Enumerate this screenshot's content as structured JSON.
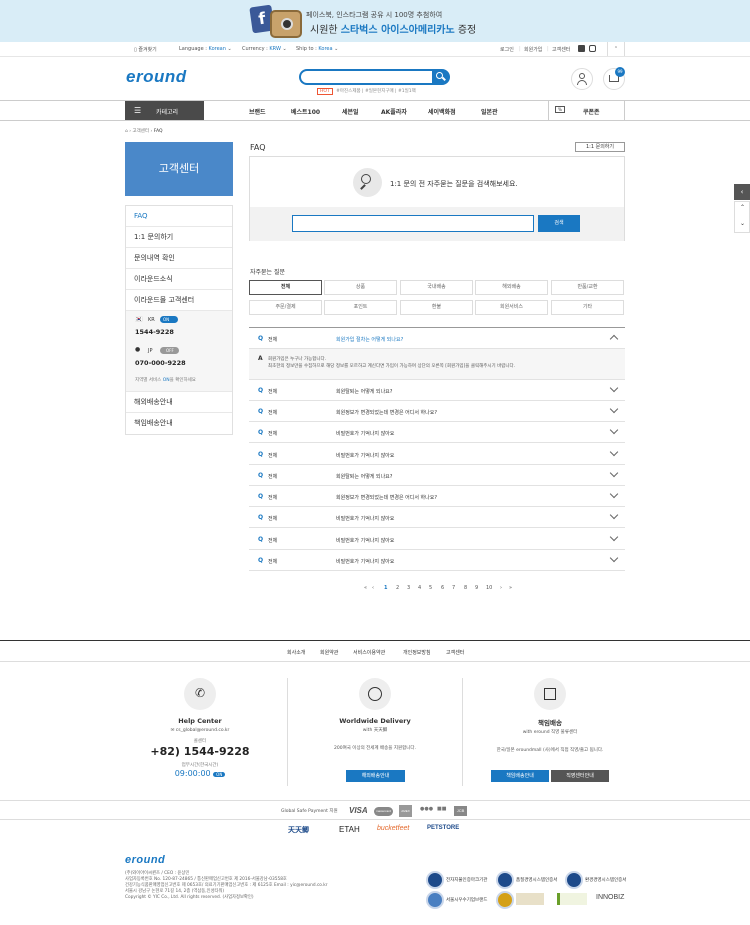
{
  "banner": {
    "fb_letter": "f",
    "line1": "페이스북, 인스타그램 공유 시 100명 추첨하여",
    "line2_prefix": "시원한 ",
    "line2_highlight": "스타벅스 아이스아메리카노",
    "line2_suffix": " 증정"
  },
  "util": {
    "bookmark": "즐겨찾기",
    "language_label": "Language :",
    "language_value": "Korean",
    "currency_label": "Currency :",
    "currency_value": "KRW",
    "ship_label": "Ship to :",
    "ship_value": "Korea",
    "login": "로그인",
    "join": "회원가입",
    "cs": "고객센터"
  },
  "header": {
    "logo": "eround",
    "search_placeholder": "",
    "search_tags": [
      "HOT",
      "#마진스제품",
      "#일본현지구매",
      "#1일1팩"
    ],
    "cart_count": "99"
  },
  "nav": {
    "category": "카테고리",
    "items": [
      "브랜드",
      "베스트100",
      "세븐일",
      "AK플라자",
      "세이백화점",
      "일본관"
    ],
    "coupon": "쿠폰존"
  },
  "breadcrumb": [
    "고객센터",
    "FAQ"
  ],
  "sidebar": {
    "title": "고객센터",
    "items": [
      "FAQ",
      "1:1 문의하기",
      "문의내역 확인",
      "이라운드소식",
      "이라운드몰 고객센터"
    ],
    "cs_kr": {
      "country": "KR",
      "status": "ON",
      "phone": "1544-9228"
    },
    "cs_jp": {
      "country": "JP",
      "status": "OFF",
      "phone": "070-000-9228"
    },
    "cs_note_prefix": "지역별 서비스 ",
    "cs_note_on": "ON",
    "cs_note_suffix": "을 확인하세요",
    "items2": [
      "해외배송안내",
      "책임배송안내"
    ]
  },
  "faq": {
    "title": "FAQ",
    "inquiry_button": "1:1 문의하기",
    "search_heading": "1:1 문의 전 자주묻는 질문을 검색해보세요.",
    "search_input": "",
    "search_button": "검색",
    "categories_title": "자주묻는 질문",
    "categories": [
      "전체",
      "상품",
      "국내배송",
      "해외배송",
      "반품/교환",
      "주문/결제",
      "포인트",
      "환불",
      "회원서비스",
      "기타"
    ],
    "open_answer_line1": "회원가입은 누구나 가능합니다.",
    "open_answer_line2": "최초한의 정보만을 수집하므로 해당 정보를 모르하고 계신다면 가입이 가능하며 상단의 오른쪽 [회원가입]을 클릭해주시기 바랍니다.",
    "rows": [
      {
        "cat": "전체",
        "q": "회원가입 절차는 어떻게 되나요?"
      },
      {
        "cat": "전체",
        "q": "회원탈퇴는 어떻게 되나요?"
      },
      {
        "cat": "전체",
        "q": "회원정보가 변경되었는데 변경은 어디서 하나요?"
      },
      {
        "cat": "전체",
        "q": "비밀번호가 기억나지 않아요"
      },
      {
        "cat": "전체",
        "q": "비밀번호가 기억나지 않아요"
      },
      {
        "cat": "전체",
        "q": "회원탈퇴는 어떻게 되나요?"
      },
      {
        "cat": "전체",
        "q": "회원정보가 변경되었는데 변경은 어디서 하나요?"
      },
      {
        "cat": "전체",
        "q": "비밀번호가 기억나지 않아요"
      },
      {
        "cat": "전체",
        "q": "비밀번호가 기억나지 않아요"
      },
      {
        "cat": "전체",
        "q": "비밀번호가 기억나지 않아요"
      }
    ],
    "pages": [
      "1",
      "2",
      "3",
      "4",
      "5",
      "6",
      "7",
      "8",
      "9",
      "10"
    ]
  },
  "footer": {
    "links": [
      "회사소개",
      "회원약관",
      "서비스이용약관",
      "개인정보방침",
      "고객센터"
    ],
    "help": {
      "title": "Help Center",
      "email": "cs_global@eround.co.kr",
      "phone_label": "콜센터",
      "phone": "+82) 1544-9228",
      "hours_label": "업무시간(한국시간)",
      "hours": "09:00:00",
      "status": "ON"
    },
    "delivery": {
      "title": "Worldwide Delivery",
      "sub": "with 天天鲫",
      "desc": "200여국 이상의 전세계 배송을 지원합니다.",
      "button": "해외배송안내"
    },
    "responsible": {
      "title": "책임배송",
      "sub": "with eround 직영 물류센터",
      "desc": "한국/일본 eroundmall (사)에서 직접 직영/출고 됩니다.",
      "button1": "책임배송안내",
      "button2": "직영센터안내"
    },
    "pay_label": "Global Safe Payment 지원",
    "pay_methods": [
      "VISA",
      "mastercard",
      "AMEX",
      "JCB"
    ],
    "partners": [
      "天天鲫",
      "ETAH",
      "bucketfeet",
      "PETSTORE"
    ],
    "logo": "eround",
    "company": [
      "(주)와이아이씨퀸즈 / CEO : 윤상민",
      "사업자등록번호 No. 120-87-24865 / 통신판매업신고번호 제 2016-서울강남-03558호",
      "건강기능식품판매영업신고번호 제 0653호/ 의료기기판매업신고번호 : 제 6125호 Email : yic@eround.co.kr",
      "서울시 강남구 논현로 71길 14, 2층 (역삼동,인성타워)",
      "Copyright © YIC Co., Ltd. All rights reserved. (사업자정보확인)"
    ],
    "certs": [
      "전자지불인증마크기관",
      "품질경영시스템인증서",
      "환경경영시스템인증서",
      "서울시우수기업브랜드",
      "",
      "INNOBIZ"
    ]
  }
}
